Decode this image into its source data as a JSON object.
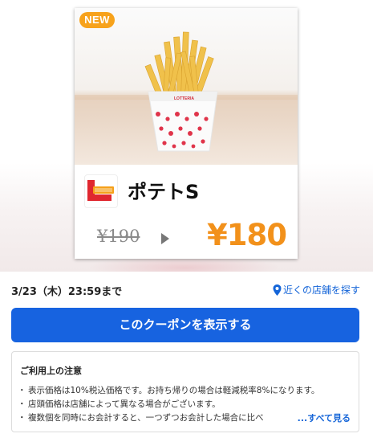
{
  "coupon": {
    "badge": "NEW",
    "product_name": "ポテトS",
    "brand_logo_icon": "lotteria-logo-icon",
    "original_price": "¥190",
    "coupon_price": "¥180",
    "price_color": "#f2911b",
    "badge_color": "#f7a21b"
  },
  "meta": {
    "expiry": "3/23（木）23:59まで",
    "store_link": "近くの店舗を探す",
    "store_link_icon": "location-pin-icon"
  },
  "actions": {
    "show_coupon_label": "このクーポンを表示する",
    "button_color": "#1763e0"
  },
  "notes": {
    "title": "ご利用上の注意",
    "items": [
      "表示価格は10%税込価格です。お持ち帰りの場合は軽減税率8%になります。",
      "店頭価格は店舗によって異なる場合がございます。",
      "複数個を同時にお会計すると、一つずつお会計した場合に比べ"
    ],
    "see_all_label": "...すべて見る"
  }
}
